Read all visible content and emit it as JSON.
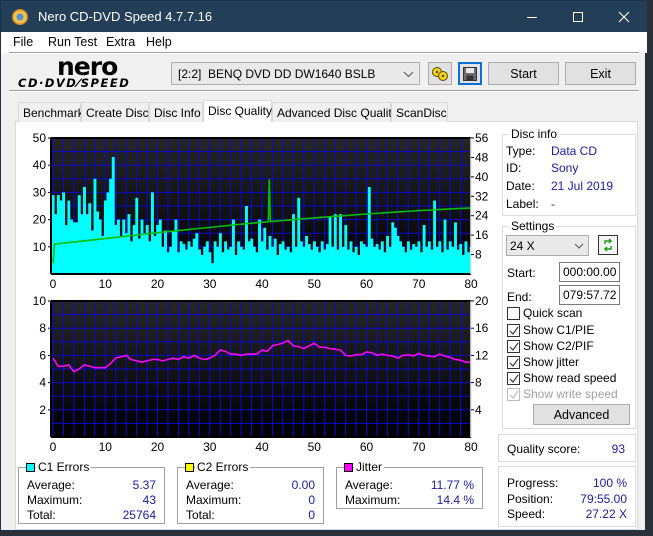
{
  "window": {
    "title": "Nero CD-DVD Speed 4.7.7.16",
    "controls": [
      "minimize",
      "maximize",
      "close"
    ]
  },
  "menu": [
    "File",
    "Run Test",
    "Extra",
    "Help"
  ],
  "logo": {
    "line1": "nero",
    "line2": "CD·DVD⁄SPEED"
  },
  "toolbar": {
    "drive": "[2:2]  BENQ DVD DD DW1640 BSLB",
    "start_label": "Start",
    "exit_label": "Exit",
    "icons": [
      "disc-swap-icon",
      "save-icon"
    ]
  },
  "tabs": [
    {
      "label": "Benchmark",
      "active": false
    },
    {
      "label": "Create Disc",
      "active": false
    },
    {
      "label": "Disc Info",
      "active": false
    },
    {
      "label": "Disc Quality",
      "active": true
    },
    {
      "label": "Advanced Disc Quality",
      "active": false
    },
    {
      "label": "ScanDisc",
      "active": false
    }
  ],
  "disc_info": {
    "title": "Disc info",
    "type_label": "Type:",
    "type": "Data CD",
    "id_label": "ID:",
    "id": "Sony",
    "date_label": "Date:",
    "date": "21 Jul 2019",
    "label_label": "Label:",
    "label": "-"
  },
  "settings": {
    "title": "Settings",
    "speed": "24 X",
    "start_label": "Start:",
    "start": "000:00.00",
    "end_label": "End:",
    "end": "079:57.72",
    "checkboxes": [
      {
        "label": "Quick scan",
        "checked": false,
        "enabled": true
      },
      {
        "label": "Show C1/PIE",
        "checked": true,
        "enabled": true
      },
      {
        "label": "Show C2/PIF",
        "checked": true,
        "enabled": true
      },
      {
        "label": "Show jitter",
        "checked": true,
        "enabled": true
      },
      {
        "label": "Show read speed",
        "checked": true,
        "enabled": true
      },
      {
        "label": "Show write speed",
        "checked": true,
        "enabled": false
      }
    ],
    "advanced_label": "Advanced"
  },
  "quality": {
    "label": "Quality score:",
    "value": "93"
  },
  "progress": {
    "progress_label": "Progress:",
    "progress": "100 %",
    "position_label": "Position:",
    "position": "79:55.00",
    "speed_label": "Speed:",
    "speed": "27.22 X"
  },
  "stats": {
    "c1": {
      "title": "C1 Errors",
      "color": "#00ffff",
      "average_label": "Average:",
      "average": "5.37",
      "maximum_label": "Maximum:",
      "maximum": "43",
      "total_label": "Total:",
      "total": "25764"
    },
    "c2": {
      "title": "C2 Errors",
      "color": "#ffff00",
      "average_label": "Average:",
      "average": "0.00",
      "maximum_label": "Maximum:",
      "maximum": "0",
      "total_label": "Total:",
      "total": "0"
    },
    "jitter": {
      "title": "Jitter",
      "color": "#ff00ff",
      "average_label": "Average:",
      "average": "11.77 %",
      "maximum_label": "Maximum:",
      "maximum": "14.4 %"
    }
  },
  "chart_data": [
    {
      "type": "bar",
      "xlim": [
        0,
        80
      ],
      "xticks": [
        0,
        10,
        20,
        30,
        40,
        50,
        60,
        70,
        80
      ],
      "ylim_left": [
        0,
        50
      ],
      "yticks_left": [
        10,
        20,
        30,
        40,
        50
      ],
      "ylim_right": [
        0,
        56
      ],
      "yticks_right": [
        8,
        16,
        24,
        32,
        40,
        48,
        56
      ],
      "grid": true,
      "grid_x_step": 2,
      "grid_y_step_left": 5,
      "series": [
        {
          "name": "C1 Errors",
          "type": "bar",
          "axis": "left",
          "color": "#00ffff",
          "x_start": 0,
          "x_step": 0.5,
          "values": [
            29,
            22,
            29,
            27,
            30,
            18,
            27,
            20,
            19,
            19,
            29,
            22,
            32,
            22,
            26,
            16,
            35,
            23,
            20,
            14,
            27,
            30,
            35,
            43,
            18,
            20,
            14,
            20,
            15,
            22,
            12,
            18,
            28,
            13,
            20,
            15,
            18,
            12,
            30,
            14,
            18,
            20,
            10,
            16,
            8,
            10,
            16,
            20,
            8,
            12,
            11,
            9,
            12,
            10,
            13,
            15,
            9,
            7,
            10,
            12,
            8,
            4,
            12,
            10,
            15,
            8,
            12,
            9,
            10,
            20,
            7,
            12,
            10,
            9,
            25,
            12,
            13,
            10,
            8,
            20,
            12,
            17,
            9,
            14,
            10,
            13,
            7,
            11,
            12,
            9,
            10,
            8,
            22,
            10,
            28,
            12,
            10,
            14,
            11,
            9,
            12,
            10,
            8,
            12,
            9,
            11,
            21,
            10,
            22,
            9,
            22,
            10,
            18,
            9,
            12,
            8,
            10,
            7,
            12,
            11,
            10,
            32,
            13,
            10,
            11,
            9,
            12,
            8,
            14,
            10,
            19,
            17,
            14,
            12,
            10,
            8,
            12,
            9,
            11,
            10,
            12,
            8,
            18,
            10,
            12,
            9,
            27,
            10,
            12,
            8,
            20,
            9,
            12,
            10,
            19,
            9,
            11,
            7,
            12,
            8,
            10
          ]
        },
        {
          "name": "Read Speed",
          "type": "line",
          "axis": "right",
          "color": "#00c000",
          "points": [
            [
              0,
              4.5
            ],
            [
              0.3,
              12.3
            ],
            [
              5,
              13.4
            ],
            [
              10,
              14.6
            ],
            [
              15,
              15.8
            ],
            [
              20,
              17.0
            ],
            [
              25,
              18.1
            ],
            [
              30,
              19.2
            ],
            [
              35,
              20.3
            ],
            [
              40,
              21.3
            ],
            [
              41.2,
              21.5
            ],
            [
              41.4,
              39
            ],
            [
              41.6,
              21.6
            ],
            [
              45,
              22.2
            ],
            [
              50,
              23.1
            ],
            [
              55,
              23.9
            ],
            [
              60,
              24.7
            ],
            [
              65,
              25.4
            ],
            [
              70,
              26.1
            ],
            [
              75,
              26.7
            ],
            [
              80,
              27.2
            ]
          ]
        }
      ]
    },
    {
      "type": "line",
      "xlim": [
        0,
        80
      ],
      "xticks": [
        0,
        10,
        20,
        30,
        40,
        50,
        60,
        70,
        80
      ],
      "ylim_left": [
        0,
        10
      ],
      "yticks_left": [
        2,
        4,
        6,
        8,
        10
      ],
      "ylim_right": [
        0,
        20
      ],
      "yticks_right": [
        4,
        8,
        12,
        16,
        20
      ],
      "grid": true,
      "grid_x_step": 2,
      "grid_y_step_left": 1,
      "series": [
        {
          "name": "Jitter",
          "type": "line",
          "axis": "right",
          "color": "#ff00ff",
          "x_start": 0,
          "x_step": 1,
          "values": [
            11.6,
            10.4,
            10.4,
            10.6,
            9.6,
            10.0,
            10.6,
            10.4,
            10.2,
            10.2,
            10.2,
            10.8,
            11.6,
            11.8,
            12.0,
            11.4,
            11.2,
            11.0,
            11.2,
            11.4,
            11.4,
            11.2,
            11.4,
            11.6,
            11.4,
            11.8,
            11.6,
            12.0,
            11.6,
            11.4,
            11.6,
            12.0,
            12.8,
            12.6,
            12.2,
            12.2,
            12.0,
            12.2,
            12.2,
            12.2,
            12.8,
            12.6,
            13.4,
            13.6,
            13.8,
            14.2,
            13.4,
            13.3,
            13.0,
            13.4,
            13.8,
            13.2,
            13.2,
            13.0,
            12.9,
            12.8,
            12.0,
            11.9,
            12.1,
            12.1,
            12.5,
            12.4,
            12.0,
            12.2,
            12.0,
            11.9,
            11.6,
            12.0,
            12.1,
            11.9,
            12.3,
            12.0,
            11.9,
            11.8,
            12.2,
            11.9,
            11.7,
            11.4,
            11.3,
            11.0,
            11.0
          ]
        }
      ]
    }
  ]
}
